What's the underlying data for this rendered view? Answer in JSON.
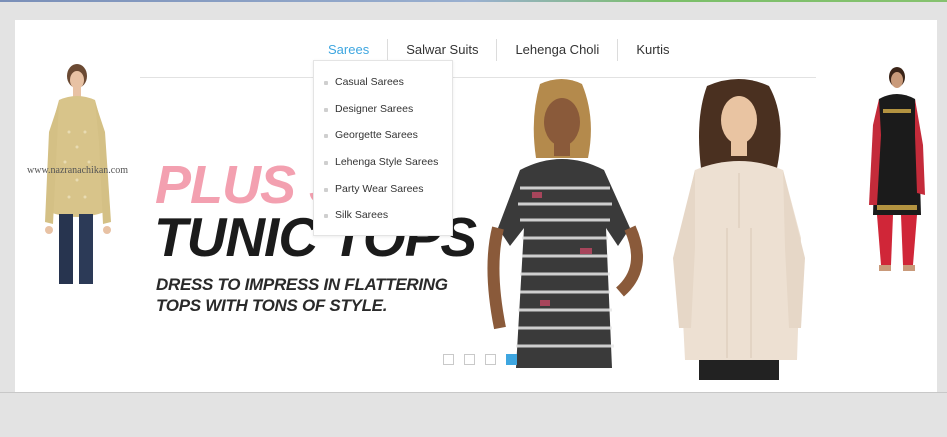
{
  "nav": {
    "items": [
      "Sarees",
      "Salwar Suits",
      "Lehenga Choli",
      "Kurtis"
    ],
    "active_index": 0,
    "accent_color": "#3ea6e0"
  },
  "dropdown": {
    "items": [
      "Casual Sarees",
      "Designer Sarees",
      "Georgette Sarees",
      "Lehenga Style Sarees",
      "Party Wear Sarees",
      "Silk Sarees"
    ]
  },
  "banner": {
    "headline_1": "PLUS S",
    "headline_2": "TUNIC TOPS",
    "subline_1": "DRESS TO IMPRESS IN FLATTERING",
    "subline_2": "TOPS WITH TONS OF STYLE.",
    "watermark": "www.nazranachikan.com"
  },
  "slider": {
    "slide_count": 4,
    "active_slide": 4
  }
}
